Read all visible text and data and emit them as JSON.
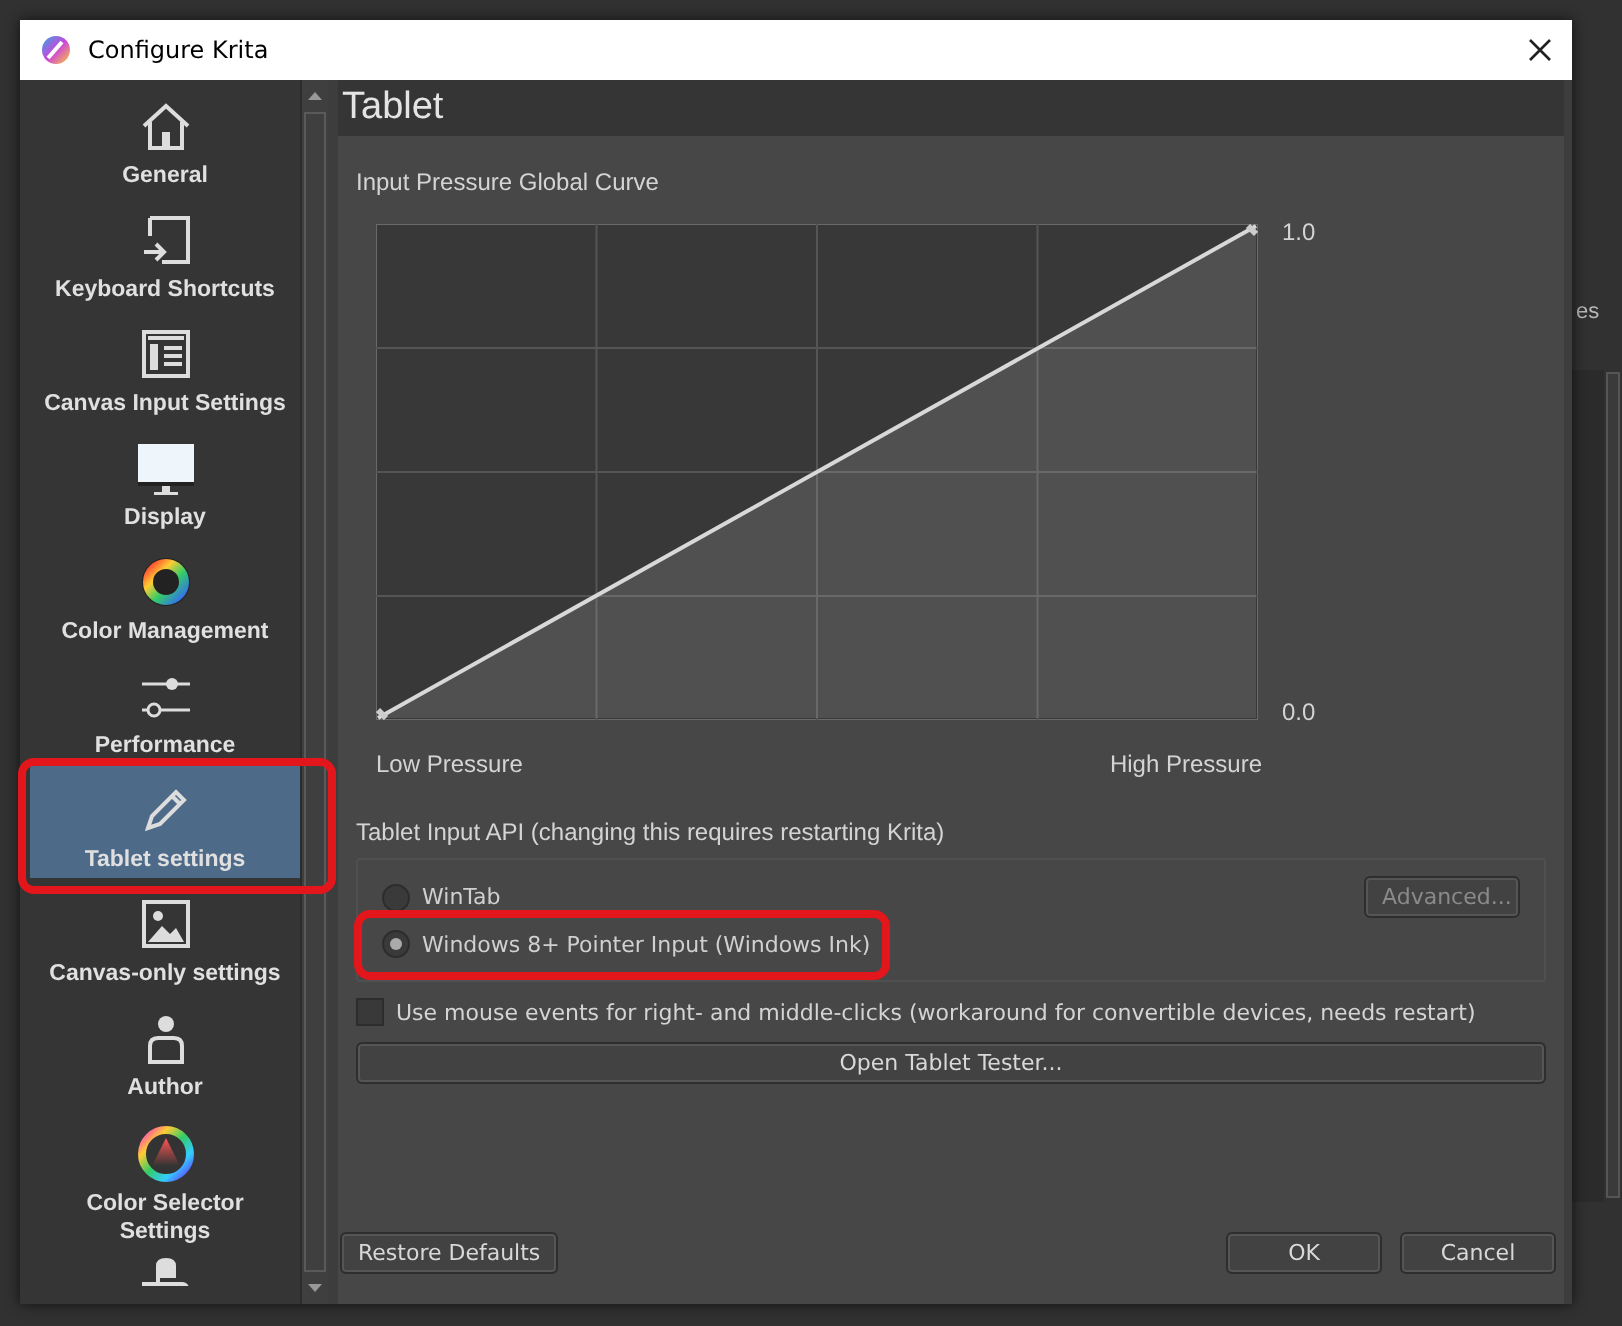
{
  "window": {
    "title": "Configure Krita"
  },
  "sidebar": {
    "items": [
      {
        "label": "General",
        "selected": false,
        "highlighted": false
      },
      {
        "label": "Keyboard Shortcuts",
        "selected": false,
        "highlighted": false
      },
      {
        "label": "Canvas Input Settings",
        "selected": false,
        "highlighted": false
      },
      {
        "label": "Display",
        "selected": false,
        "highlighted": false
      },
      {
        "label": "Color Management",
        "selected": false,
        "highlighted": false
      },
      {
        "label": "Performance",
        "selected": false,
        "highlighted": false
      },
      {
        "label": "Tablet settings",
        "selected": true,
        "highlighted": true
      },
      {
        "label": "Canvas-only settings",
        "selected": false,
        "highlighted": false
      },
      {
        "label": "Author",
        "selected": false,
        "highlighted": false
      },
      {
        "label": "Color Selector Settings",
        "selected": false,
        "highlighted": false
      }
    ]
  },
  "page": {
    "title": "Tablet",
    "curve": {
      "title": "Input Pressure Global Curve",
      "y_max_label": "1.0",
      "y_min_label": "0.0",
      "x_min_label": "Low Pressure",
      "x_max_label": "High Pressure"
    },
    "api_group": {
      "title": "Tablet Input API (changing this requires restarting Krita)",
      "options": [
        {
          "label": "WinTab",
          "selected": false,
          "highlighted": false
        },
        {
          "label": "Windows 8+ Pointer Input (Windows Ink)",
          "selected": true,
          "highlighted": true
        }
      ],
      "advanced_button": {
        "label": "Advanced...",
        "disabled": true
      }
    },
    "mouse_events": {
      "label": "Use mouse events for right- and middle-clicks (workaround for convertible devices, needs restart)",
      "checked": false
    },
    "tester_button": "Open Tablet Tester..."
  },
  "buttons": {
    "restore": "Restore Defaults",
    "ok": "OK",
    "cancel": "Cancel"
  },
  "background": {
    "fragments": [
      "es"
    ]
  }
}
